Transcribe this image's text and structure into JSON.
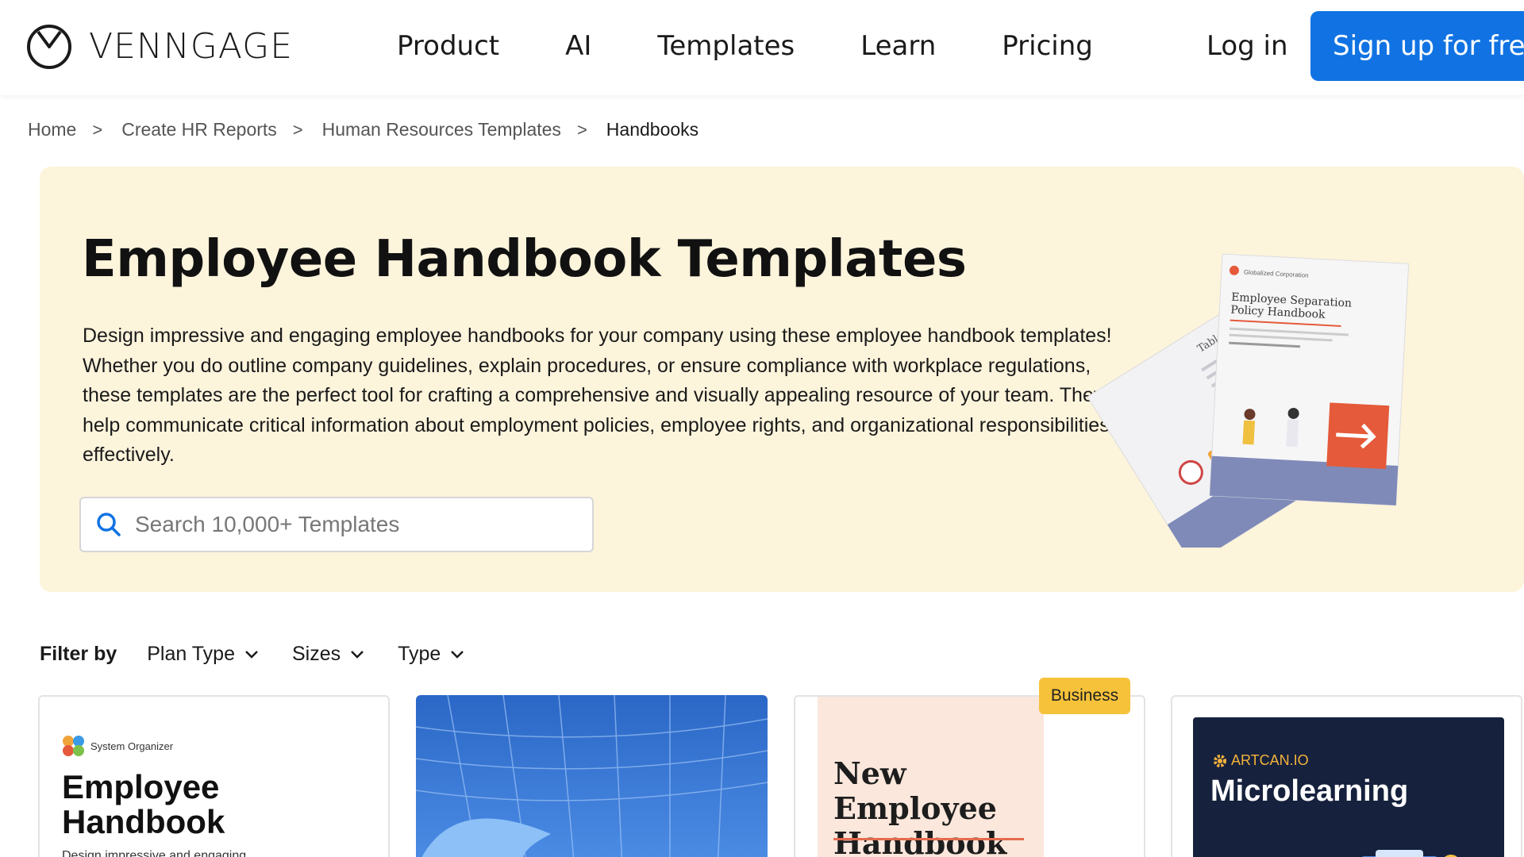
{
  "brand": {
    "name": "VENNGAGE"
  },
  "nav": {
    "items": [
      "Product",
      "AI",
      "Templates",
      "Learn",
      "Pricing"
    ],
    "login": "Log in",
    "signup": "Sign up for free"
  },
  "breadcrumb": [
    "Home",
    "Create HR Reports",
    "Human Resources Templates",
    "Handbooks"
  ],
  "hero": {
    "title": "Employee Handbook Templates",
    "description": "Design impressive and engaging employee handbooks for your company using these employee handbook templates! Whether you do outline company guidelines, explain procedures, or ensure compliance with workplace regulations, these templates are the perfect tool for crafting a comprehensive and visually appealing resource of your team. They help communicate critical information about employment policies, employee rights, and organizational responsibilities effectively.",
    "search_placeholder": "Search 10,000+ Templates",
    "illustration": {
      "doc_title": "Employee Separation Policy Handbook",
      "back_doc_title": "Table of Contents",
      "company": "Globalized Corporation"
    }
  },
  "filters": {
    "label": "Filter by",
    "items": [
      "Plan Type",
      "Sizes",
      "Type"
    ]
  },
  "cards": [
    {
      "org": "System Organizer",
      "title_line1": "Employee",
      "title_line2": "Handbook",
      "desc": "Design impressive and engaging"
    },
    {
      "title": ""
    },
    {
      "badge": "Business",
      "title_line1": "New Employee",
      "title_line2": "Handbook"
    },
    {
      "brand": "ARTCAN.IO",
      "title": "Microlearning"
    }
  ],
  "colors": {
    "primary": "#1173e3",
    "hero_bg": "#fdf4dc",
    "badge": "#f6c23a"
  }
}
